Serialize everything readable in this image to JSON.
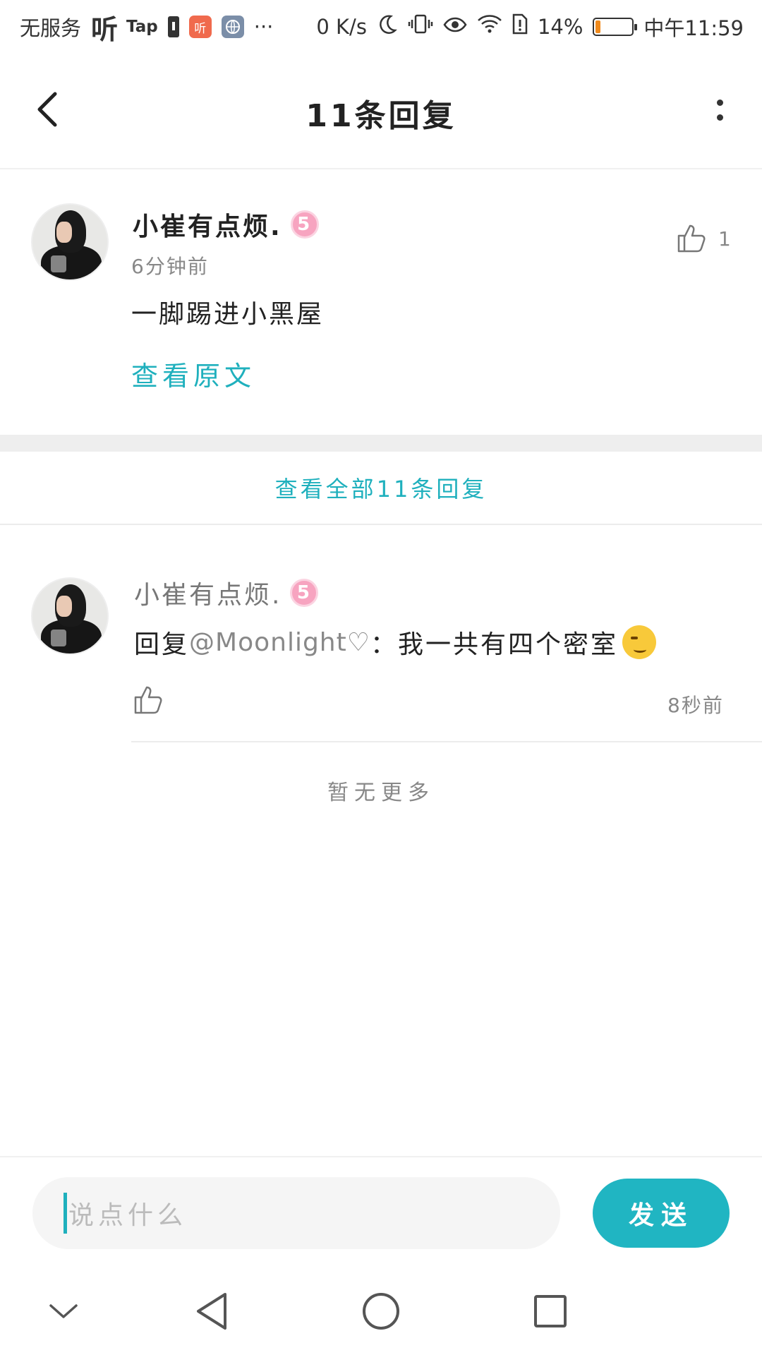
{
  "status_bar": {
    "no_service": "无服务",
    "ting_icon_text": "听",
    "tap_text": "Tap",
    "ting_app_text": "听",
    "more": "···",
    "net_speed": "0 K/s",
    "battery_percent": "14%",
    "battery_level": 0.14,
    "battery_color": "#f08a1c",
    "time": "中午11:59"
  },
  "header": {
    "title": "11条回复"
  },
  "main_comment": {
    "username": "小崔有点烦.",
    "level": "5",
    "timestamp": "6分钟前",
    "text": "一脚踢进小黑屋",
    "view_original": "查看原文",
    "like_count": "1"
  },
  "view_all_label": "查看全部11条回复",
  "reply": {
    "username": "小崔有点烦.",
    "level": "5",
    "prefix": "回复",
    "mention": "@Moonlight♡",
    "colon": "：",
    "text": "我一共有四个密室",
    "time": "8秒前"
  },
  "no_more": "暂无更多",
  "input": {
    "placeholder": "说点什么",
    "send_label": "发送"
  },
  "colors": {
    "accent": "#1fb0bd",
    "send_button": "#20b5c2",
    "level_badge": "#f7a4c0"
  }
}
